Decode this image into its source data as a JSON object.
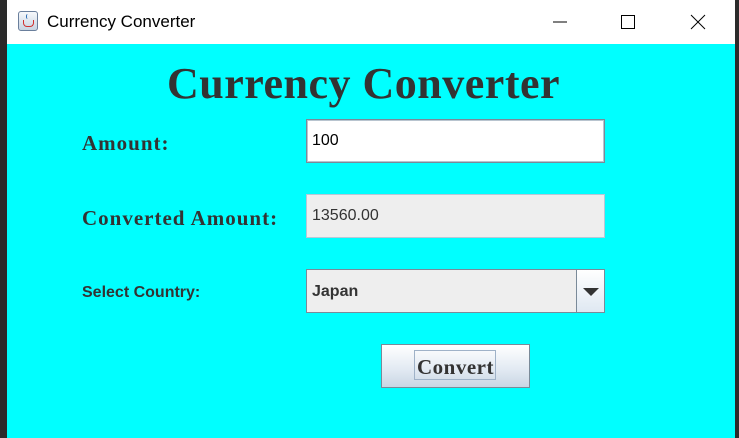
{
  "window": {
    "title": "Currency Converter"
  },
  "form": {
    "heading": "Currency Converter",
    "amount_label": "Amount:",
    "amount_value": "100",
    "converted_label": "Converted Amount:",
    "converted_value": "13560.00",
    "country_label": "Select Country:",
    "country_selected": "Japan",
    "convert_label": "Convert"
  },
  "colors": {
    "background": "#00ffff",
    "text": "#333333",
    "titlebar": "#ffffff"
  },
  "icons": {
    "app": "java-coffee-cup-icon",
    "minimize": "minimize-icon",
    "maximize": "maximize-icon",
    "close": "close-icon",
    "dropdown": "chevron-down-icon"
  }
}
